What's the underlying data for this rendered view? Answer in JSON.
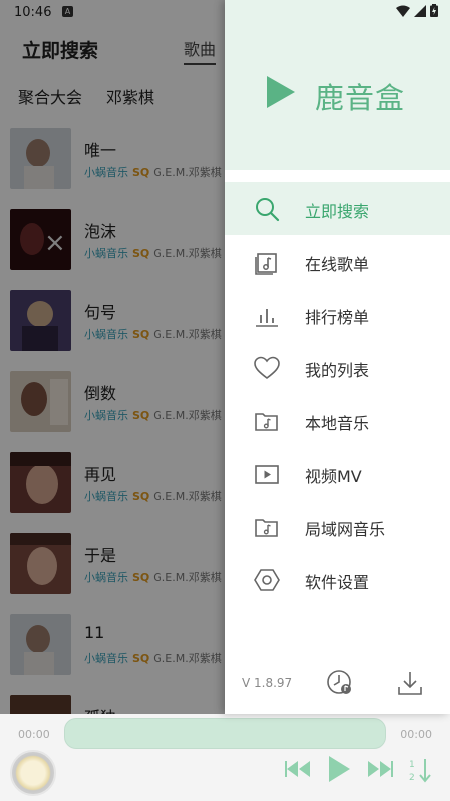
{
  "status": {
    "time": "10:46",
    "notification_glyph": "A"
  },
  "page": {
    "title": "立即搜索",
    "category_tab": "歌曲",
    "filters": [
      "聚合大会",
      "邓紫棋"
    ]
  },
  "songs": [
    {
      "title": "唯一",
      "source": "小蜗音乐",
      "quality": "SQ",
      "artist": "G.E.M.邓紫棋 ",
      "cover_color": "#cfd6da"
    },
    {
      "title": "泡沫",
      "source": "小蜗音乐",
      "quality": "SQ",
      "artist": "G.E.M.邓紫棋 X",
      "cover_color": "#3a1a1e"
    },
    {
      "title": "句号",
      "source": "小蜗音乐",
      "quality": "SQ",
      "artist": "G.E.M.邓紫棋 局",
      "cover_color": "#5a4c7a"
    },
    {
      "title": "倒数",
      "source": "小蜗音乐",
      "quality": "SQ",
      "artist": "G.E.M.邓紫棋 系",
      "cover_color": "#b8a89a"
    },
    {
      "title": "再见",
      "source": "小蜗音乐",
      "quality": "SQ",
      "artist": "G.E.M.邓紫棋 新",
      "cover_color": "#8a5a4e"
    },
    {
      "title": "于是",
      "source": "小蜗音乐",
      "quality": "SQ",
      "artist": "G.E.M.邓紫棋 新",
      "cover_color": "#9a6a5a"
    },
    {
      "title": "11",
      "source": "小蜗音乐",
      "quality": "SQ",
      "artist": "G.E.M.邓紫棋 ",
      "cover_color": "#cfd6da"
    },
    {
      "title": "孤独",
      "source": "",
      "quality": "",
      "artist": "",
      "cover_color": "#c9a070"
    }
  ],
  "drawer": {
    "brand": "鹿音盒",
    "menu": [
      {
        "label": "立即搜索",
        "icon": "search-icon",
        "active": true
      },
      {
        "label": "在线歌单",
        "icon": "playlist-icon",
        "active": false
      },
      {
        "label": "排行榜单",
        "icon": "chart-icon",
        "active": false
      },
      {
        "label": "我的列表",
        "icon": "heart-icon",
        "active": false
      },
      {
        "label": "本地音乐",
        "icon": "folder-music-icon",
        "active": false
      },
      {
        "label": "视频MV",
        "icon": "video-icon",
        "active": false
      },
      {
        "label": "局域网音乐",
        "icon": "lan-folder-icon",
        "active": false
      },
      {
        "label": "软件设置",
        "icon": "settings-icon",
        "active": false
      }
    ],
    "version": "V 1.8.97"
  },
  "player": {
    "current_time": "00:00",
    "total_time": "00:00",
    "progress": 0
  },
  "colors": {
    "accent": "#5ab385",
    "accent_light": "#e7f3ec",
    "source_text": "#3aa0b8",
    "quality_badge": "#e29b21"
  }
}
